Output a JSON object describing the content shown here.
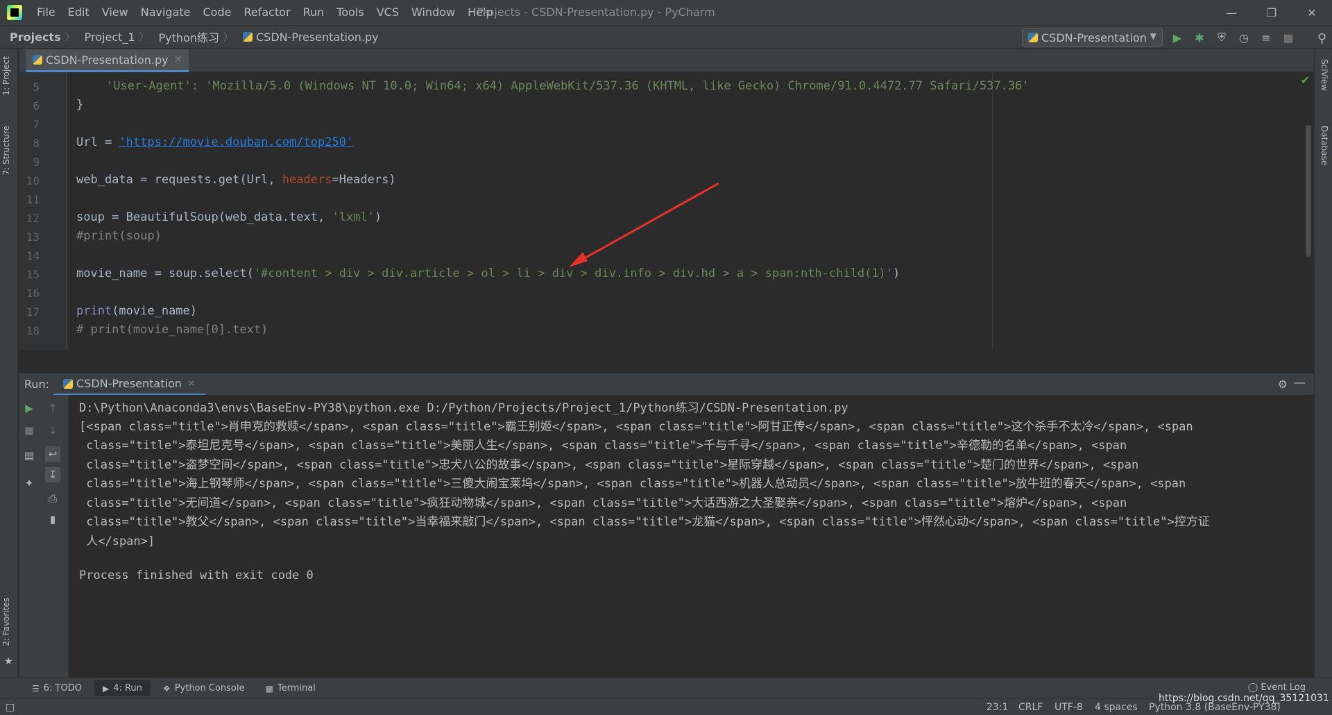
{
  "menu": {
    "items": [
      "File",
      "Edit",
      "View",
      "Navigate",
      "Code",
      "Refactor",
      "Run",
      "Tools",
      "VCS",
      "Window",
      "Help"
    ],
    "window_title": "Projects - CSDN-Presentation.py - PyCharm"
  },
  "breadcrumbs": {
    "root": "Projects",
    "project": "Project_1",
    "folder": "Python练习",
    "file": "CSDN-Presentation.py"
  },
  "run_config": {
    "name": "CSDN-Presentation"
  },
  "side_tabs": {
    "project": "1: Project",
    "structure": "7: Structure",
    "favorites": "2: Favorites",
    "sciview": "SciView",
    "database": "Database"
  },
  "editor": {
    "tab_label": "CSDN-Presentation.py",
    "line_numbers": [
      "5",
      "6",
      "7",
      "8",
      "9",
      "10",
      "11",
      "12",
      "13",
      "14",
      "15",
      "16",
      "17",
      "18"
    ],
    "lines": {
      "l5": "'User-Agent': 'Mozilla/5.0 (Windows NT 10.0; Win64; x64) AppleWebKit/537.36 (KHTML, like Gecko) Chrome/91.0.4472.77 Safari/537.36'",
      "l6": "}",
      "l8a": "Url = ",
      "l8b": "'https://movie.douban.com/top250'",
      "l10a": "web_data = requests.get(Url, ",
      "l10b": "headers",
      "l10c": "=Headers)",
      "l12a": "soup = BeautifulSoup(web_data.text, ",
      "l12b": "'lxml'",
      "l12c": ")",
      "l13": "#print(soup)",
      "l15a": "movie_name = soup.select(",
      "l15b": "'#content > div > div.article > ol > li > div > div.info > div.hd > a > span:nth-child(1)'",
      "l15c": ")",
      "l17a": "print",
      "l17b": "(movie_name)",
      "l18": "# print(movie_name[0].text)"
    }
  },
  "run_panel": {
    "label": "Run:",
    "tab": "CSDN-Presentation",
    "output": [
      "D:\\Python\\Anaconda3\\envs\\BaseEnv-PY38\\python.exe D:/Python/Projects/Project_1/Python练习/CSDN-Presentation.py",
      "[<span class=\"title\">肖申克的救赎</span>, <span class=\"title\">霸王别姬</span>, <span class=\"title\">阿甘正传</span>, <span class=\"title\">这个杀手不太冷</span>, <span",
      " class=\"title\">泰坦尼克号</span>, <span class=\"title\">美丽人生</span>, <span class=\"title\">千与千寻</span>, <span class=\"title\">辛德勒的名单</span>, <span",
      " class=\"title\">盗梦空间</span>, <span class=\"title\">忠犬八公的故事</span>, <span class=\"title\">星际穿越</span>, <span class=\"title\">楚门的世界</span>, <span",
      " class=\"title\">海上钢琴师</span>, <span class=\"title\">三傻大闹宝莱坞</span>, <span class=\"title\">机器人总动员</span>, <span class=\"title\">放牛班的春天</span>, <span",
      " class=\"title\">无间道</span>, <span class=\"title\">疯狂动物城</span>, <span class=\"title\">大话西游之大圣娶亲</span>, <span class=\"title\">熔炉</span>, <span",
      " class=\"title\">教父</span>, <span class=\"title\">当幸福来敲门</span>, <span class=\"title\">龙猫</span>, <span class=\"title\">怦然心动</span>, <span class=\"title\">控方证",
      " 人</span>]",
      "",
      "Process finished with exit code 0"
    ]
  },
  "bottom_tabs": {
    "todo": "6: TODO",
    "run": "4: Run",
    "python_console": "Python Console",
    "terminal": "Terminal",
    "event_log": "Event Log"
  },
  "status": {
    "position": "23:1",
    "line_sep": "CRLF",
    "encoding": "UTF-8",
    "indent": "4 spaces",
    "interpreter": "Python 3.8 (BaseEnv-PY38)"
  },
  "watermark": "https://blog.csdn.net/qq_35121031",
  "colors": {
    "background": "#2b2b2b",
    "panel": "#3c3f41",
    "string": "#6a8759",
    "keyword": "#cc7832",
    "comment": "#808080",
    "annotation_arrow": "#e8302a"
  }
}
